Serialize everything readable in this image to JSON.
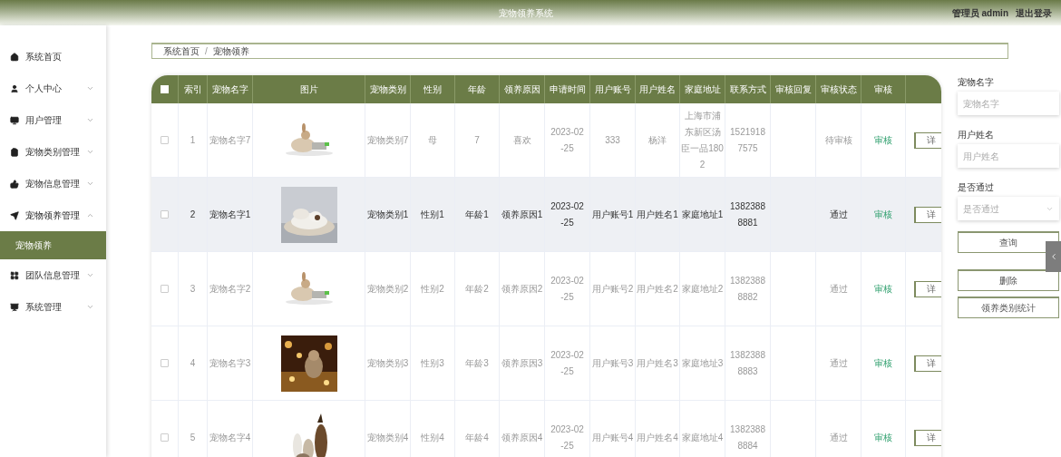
{
  "header": {
    "title": "宠物领养系统",
    "user": "管理员 admin",
    "logout": "退出登录"
  },
  "sidebar": {
    "items": [
      {
        "kind": "link",
        "label": "系统首页"
      },
      {
        "kind": "menu",
        "label": "个人中心",
        "expanded": false
      },
      {
        "kind": "menu",
        "label": "用户管理",
        "expanded": false
      },
      {
        "kind": "menu",
        "label": "宠物类别管理",
        "expanded": false
      },
      {
        "kind": "menu",
        "label": "宠物信息管理",
        "expanded": false
      },
      {
        "kind": "menu",
        "label": "宠物领养管理",
        "expanded": true,
        "children": [
          {
            "label": "宠物领养",
            "selected": true
          }
        ]
      },
      {
        "kind": "menu",
        "label": "团队信息管理",
        "expanded": false
      },
      {
        "kind": "menu",
        "label": "系统管理",
        "expanded": false
      }
    ]
  },
  "breadcrumb": {
    "separator": "/",
    "items": [
      "系统首页",
      "宠物领养"
    ]
  },
  "table": {
    "all_checked": false,
    "columns": [
      "索引",
      "宠物名字",
      "图片",
      "宠物类别",
      "性别",
      "年龄",
      "领养原因",
      "申请时间",
      "用户账号",
      "用户姓名",
      "家庭地址",
      "联系方式",
      "审核回复",
      "审核状态",
      "审核"
    ],
    "rows": [
      {
        "checked": false,
        "highlighted": false,
        "index": "1",
        "name": "宠物名字7",
        "category": "宠物类别7",
        "gender": "母",
        "age": "7",
        "reason": "喜欢",
        "time": "2023-02-25",
        "account": "333",
        "username": "杨洋",
        "address": "上海市浦东新区汤臣一品1802",
        "phone": "15219187575",
        "status": "待审核",
        "review": "审核",
        "detail": "详"
      },
      {
        "checked": false,
        "highlighted": true,
        "index": "2",
        "name": "宠物名字1",
        "category": "宠物类别1",
        "gender": "性别1",
        "age": "年龄1",
        "reason": "领养原因1",
        "time": "2023-02-25",
        "account": "用户账号1",
        "username": "用户姓名1",
        "address": "家庭地址1",
        "phone": "13823888881",
        "status": "通过",
        "review": "审核",
        "detail": "详"
      },
      {
        "checked": false,
        "highlighted": false,
        "index": "3",
        "name": "宠物名字2",
        "category": "宠物类别2",
        "gender": "性别2",
        "age": "年龄2",
        "reason": "领养原因2",
        "time": "2023-02-25",
        "account": "用户账号2",
        "username": "用户姓名2",
        "address": "家庭地址2",
        "phone": "13823888882",
        "status": "通过",
        "review": "审核",
        "detail": "详"
      },
      {
        "checked": false,
        "highlighted": false,
        "index": "4",
        "name": "宠物名字3",
        "category": "宠物类别3",
        "gender": "性别3",
        "age": "年龄3",
        "reason": "领养原因3",
        "time": "2023-02-25",
        "account": "用户账号3",
        "username": "用户姓名3",
        "address": "家庭地址3",
        "phone": "13823888883",
        "status": "通过",
        "review": "审核",
        "detail": "详"
      },
      {
        "checked": false,
        "highlighted": false,
        "index": "5",
        "name": "宠物名字4",
        "category": "宠物类别4",
        "gender": "性别4",
        "age": "年龄4",
        "reason": "领养原因4",
        "time": "2023-02-25",
        "account": "用户账号4",
        "username": "用户姓名4",
        "address": "家庭地址4",
        "phone": "13823888884",
        "status": "通过",
        "review": "审核",
        "detail": "详"
      }
    ]
  },
  "filters": [
    {
      "kind": "input",
      "label": "宠物名字",
      "placeholder": "宠物名字"
    },
    {
      "kind": "input",
      "label": "用户姓名",
      "placeholder": "用户姓名"
    },
    {
      "kind": "select",
      "label": "是否通过",
      "placeholder": "是否通过"
    }
  ],
  "buttons": [
    "查询",
    "删除",
    "领养类别统计"
  ]
}
